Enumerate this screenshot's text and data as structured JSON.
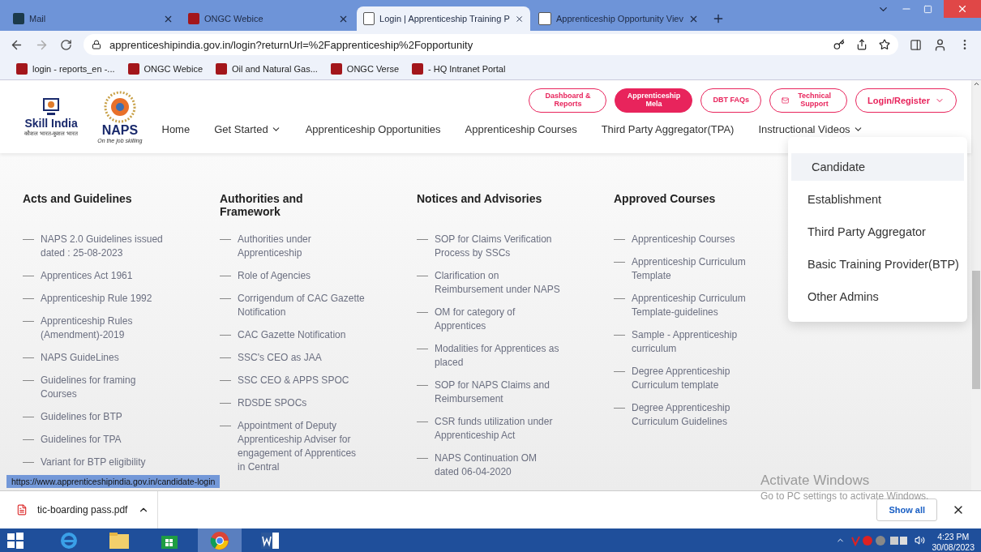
{
  "browser": {
    "tabs": [
      {
        "title": "Mail",
        "selected": false
      },
      {
        "title": "ONGC Webice",
        "selected": false
      },
      {
        "title": "Login | Apprenticeship Training P",
        "selected": true
      },
      {
        "title": "Apprenticeship Opportunity Viev",
        "selected": false
      }
    ],
    "url": "apprenticeshipindia.gov.in/login?returnUrl=%2Fapprenticeship%2Fopportunity",
    "bookmarks": [
      {
        "title": "login - reports_en -..."
      },
      {
        "title": "ONGC Webice"
      },
      {
        "title": "Oil and Natural Gas..."
      },
      {
        "title": "ONGC Verse"
      },
      {
        "title": "- HQ Intranet Portal"
      }
    ]
  },
  "site": {
    "logos": {
      "skill_title": "Skill India",
      "skill_tagline": "कौशल भारत-कुशल भारत",
      "naps_title": "NAPS",
      "naps_tagline": "On the job skilling"
    },
    "top_buttons": [
      {
        "label": "Dashboard & Reports",
        "kind": "outline"
      },
      {
        "label": "Apprenticeship Mela",
        "kind": "filled"
      },
      {
        "label": "DBT FAQs",
        "kind": "outline"
      },
      {
        "label": "Technical Support",
        "kind": "mail"
      },
      {
        "label": "Login/Register",
        "kind": "dropdown"
      }
    ],
    "nav": [
      {
        "label": "Home",
        "has_menu": false
      },
      {
        "label": "Get Started",
        "has_menu": true
      },
      {
        "label": "Apprenticeship Opportunities",
        "has_menu": false
      },
      {
        "label": "Apprenticeship Courses",
        "has_menu": false
      },
      {
        "label": "Third Party Aggregator(TPA)",
        "has_menu": false
      },
      {
        "label": "Instructional Videos",
        "has_menu": true
      }
    ],
    "login_menu": [
      {
        "label": "Candidate",
        "selected": true
      },
      {
        "label": "Establishment",
        "selected": false
      },
      {
        "label": "Third Party Aggregator",
        "selected": false
      },
      {
        "label": "Basic Training Provider(BTP)",
        "selected": false
      },
      {
        "label": "Other Admins",
        "selected": false
      }
    ],
    "columns": [
      {
        "heading": "Acts and Guidelines",
        "links": [
          "NAPS 2.0 Guidelines issued dated : 25-08-2023",
          "Apprentices Act 1961",
          "Apprenticeship Rule 1992",
          "Apprenticeship Rules (Amendment)-2019",
          "NAPS GuideLines",
          "Guidelines for framing Courses",
          "Guidelines for BTP",
          "Guidelines for TPA",
          "Variant for BTP eligibility"
        ]
      },
      {
        "heading": "Authorities and Framework",
        "links": [
          "Authorities under Apprenticeship",
          "Role of Agencies",
          "Corrigendum of CAC Gazette Notification",
          "CAC Gazette Notification",
          "SSC's CEO as JAA",
          "SSC CEO & APPS SPOC",
          "RDSDE SPOCs",
          "Appointment of Deputy Apprenticeship Adviser for engagement of Apprentices in Central"
        ]
      },
      {
        "heading": "Notices and Advisories",
        "links": [
          "SOP for Claims Verification Process by SSCs",
          "Clarification on Reimbursement under NAPS",
          "OM for category of Apprentices",
          "Modalities for Apprentices as placed",
          "SOP for NAPS Claims and Reimbursement",
          "CSR funds utilization under Apprenticeship Act",
          "NAPS Continuation OM dated 06-04-2020"
        ]
      },
      {
        "heading": "Approved Courses",
        "links": [
          "Apprenticeship Courses",
          "Apprenticeship Curriculum Template",
          "Apprenticeship Curriculum Template-guidelines",
          "Sample - Apprenticeship curriculum",
          "Degree Apprenticeship Curriculum template",
          "Degree Apprenticeship Curriculum Guidelines"
        ]
      }
    ],
    "status_url": "https://www.apprenticeshipindia.gov.in/candidate-login"
  },
  "activation": {
    "title": "Activate Windows",
    "hint": "Go to PC settings to activate Windows."
  },
  "download_bar": {
    "file": "tic-boarding pass.pdf",
    "show_all": "Show all"
  },
  "taskbar": {
    "apps": [
      {
        "selected": false
      },
      {
        "selected": false
      },
      {
        "selected": false
      },
      {
        "selected": true
      },
      {
        "selected": false
      }
    ],
    "time": "4:23 PM",
    "date": "30/08/2023"
  }
}
